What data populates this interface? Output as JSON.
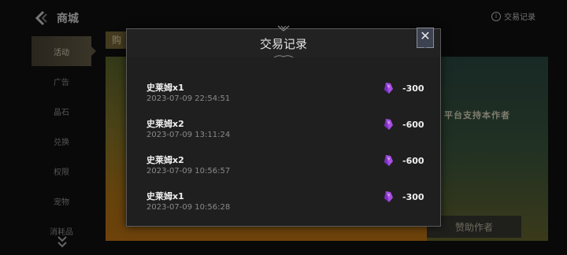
{
  "header": {
    "title": "商城",
    "record_link": "交易记录",
    "info_icon": "i"
  },
  "sidebar": {
    "items": [
      {
        "label": "活动",
        "active": true
      },
      {
        "label": "广告",
        "active": false
      },
      {
        "label": "晶石",
        "active": false
      },
      {
        "label": "兑换",
        "active": false
      },
      {
        "label": "权限",
        "active": false
      },
      {
        "label": "宠物",
        "active": false
      },
      {
        "label": "消耗品",
        "active": false
      }
    ],
    "more_icon": "chevron-double-down-icon"
  },
  "background": {
    "buy_tab": "购",
    "support_text": "平台支持本作者",
    "sponsor_button": "赞助作者"
  },
  "modal": {
    "title": "交易记录",
    "close_label": "✕",
    "records": [
      {
        "item": "史莱姆x1",
        "time": "2023-07-09 22:54:51",
        "amount": "-300"
      },
      {
        "item": "史莱姆x2",
        "time": "2023-07-09 13:11:24",
        "amount": "-600"
      },
      {
        "item": "史莱姆x2",
        "time": "2023-07-09 10:56:57",
        "amount": "-600"
      },
      {
        "item": "史莱姆x1",
        "time": "2023-07-09 10:56:28",
        "amount": "-300"
      }
    ]
  },
  "colors": {
    "gem": "#a64fe0",
    "accent_gold": "#6a604a"
  }
}
